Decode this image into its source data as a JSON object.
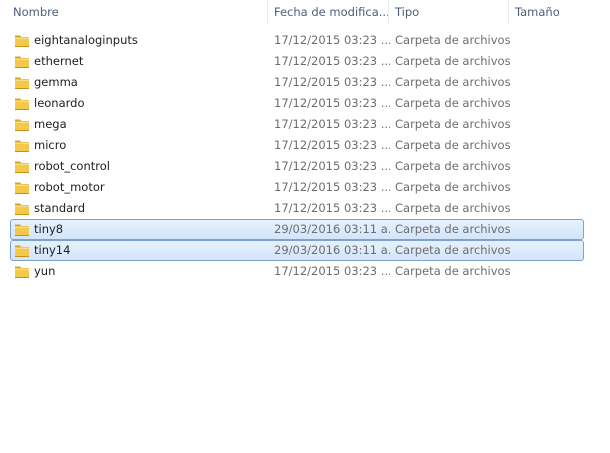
{
  "columns": {
    "name": "Nombre",
    "date": "Fecha de modifica...",
    "type": "Tipo",
    "size": "Tamaño"
  },
  "sort_indicator": "^",
  "rows": [
    {
      "name": "eightanaloginputs",
      "date": "17/12/2015 03:23 ...",
      "type": "Carpeta de archivos",
      "size": "",
      "selected": false,
      "icon": "folder-icon"
    },
    {
      "name": "ethernet",
      "date": "17/12/2015 03:23 ...",
      "type": "Carpeta de archivos",
      "size": "",
      "selected": false,
      "icon": "folder-icon"
    },
    {
      "name": "gemma",
      "date": "17/12/2015 03:23 ...",
      "type": "Carpeta de archivos",
      "size": "",
      "selected": false,
      "icon": "folder-icon"
    },
    {
      "name": "leonardo",
      "date": "17/12/2015 03:23 ...",
      "type": "Carpeta de archivos",
      "size": "",
      "selected": false,
      "icon": "folder-icon"
    },
    {
      "name": "mega",
      "date": "17/12/2015 03:23 ...",
      "type": "Carpeta de archivos",
      "size": "",
      "selected": false,
      "icon": "folder-icon"
    },
    {
      "name": "micro",
      "date": "17/12/2015 03:23 ...",
      "type": "Carpeta de archivos",
      "size": "",
      "selected": false,
      "icon": "folder-icon"
    },
    {
      "name": "robot_control",
      "date": "17/12/2015 03:23 ...",
      "type": "Carpeta de archivos",
      "size": "",
      "selected": false,
      "icon": "folder-icon"
    },
    {
      "name": "robot_motor",
      "date": "17/12/2015 03:23 ...",
      "type": "Carpeta de archivos",
      "size": "",
      "selected": false,
      "icon": "folder-icon"
    },
    {
      "name": "standard",
      "date": "17/12/2015 03:23 ...",
      "type": "Carpeta de archivos",
      "size": "",
      "selected": false,
      "icon": "folder-icon"
    },
    {
      "name": "tiny8",
      "date": "29/03/2016 03:11 a...",
      "type": "Carpeta de archivos",
      "size": "",
      "selected": true,
      "icon": "folder-icon"
    },
    {
      "name": "tiny14",
      "date": "29/03/2016 03:11 a...",
      "type": "Carpeta de archivos",
      "size": "",
      "selected": true,
      "icon": "folder-icon"
    },
    {
      "name": "yun",
      "date": "17/12/2015 03:23 ...",
      "type": "Carpeta de archivos",
      "size": "",
      "selected": false,
      "icon": "folder-icon"
    }
  ],
  "colors": {
    "header_text": "#4c607a",
    "selection_fill": "#d9e8fc",
    "selection_border": "#7da2ce",
    "folder_yellow": "#f4c94a"
  }
}
